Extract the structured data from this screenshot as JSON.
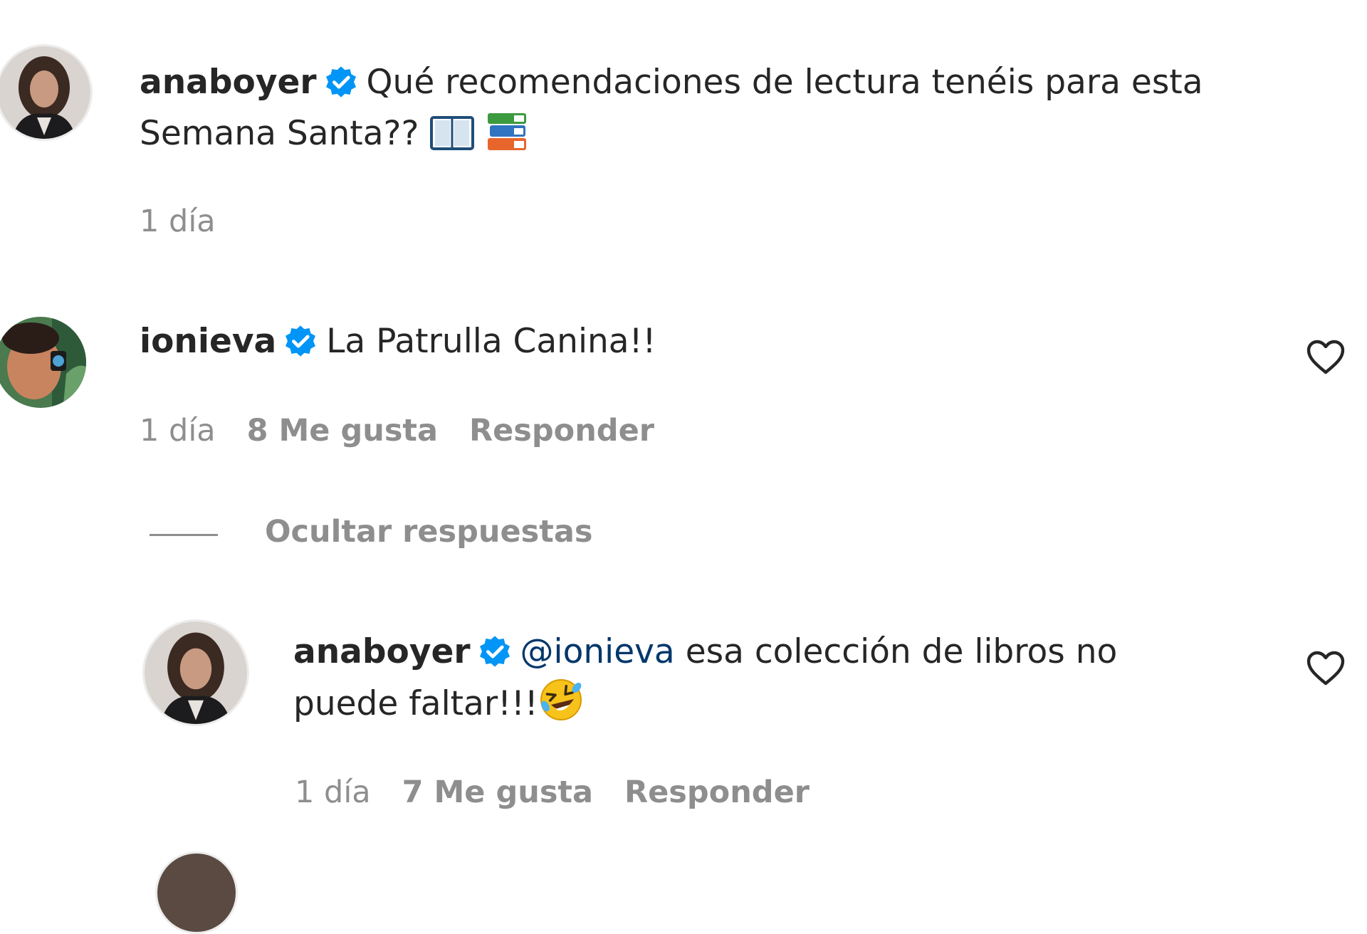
{
  "comments": [
    {
      "username": "anaboyer",
      "text": "Qué recomendaciones de lectura tenéis para esta Semana Santa??",
      "emojis": [
        "open-book-icon",
        "books-icon"
      ],
      "time": "1 día"
    },
    {
      "username": "ionieva",
      "text": "La Patrulla Canina!!",
      "time": "1 día",
      "likes": "8 Me gusta",
      "reply": "Responder"
    }
  ],
  "replies_toggle": {
    "label": "Ocultar respuestas"
  },
  "reply": {
    "username": "anaboyer",
    "mention": "@ionieva",
    "text": "esa colección de libros no puede faltar!!!",
    "emoji": "rolling-laughing-face-icon",
    "time": "1 día",
    "likes": "7 Me gusta",
    "reply": "Responder"
  },
  "colors": {
    "verified": "#0095f6",
    "meta": "#8e8e8e",
    "mention": "#00376b"
  }
}
